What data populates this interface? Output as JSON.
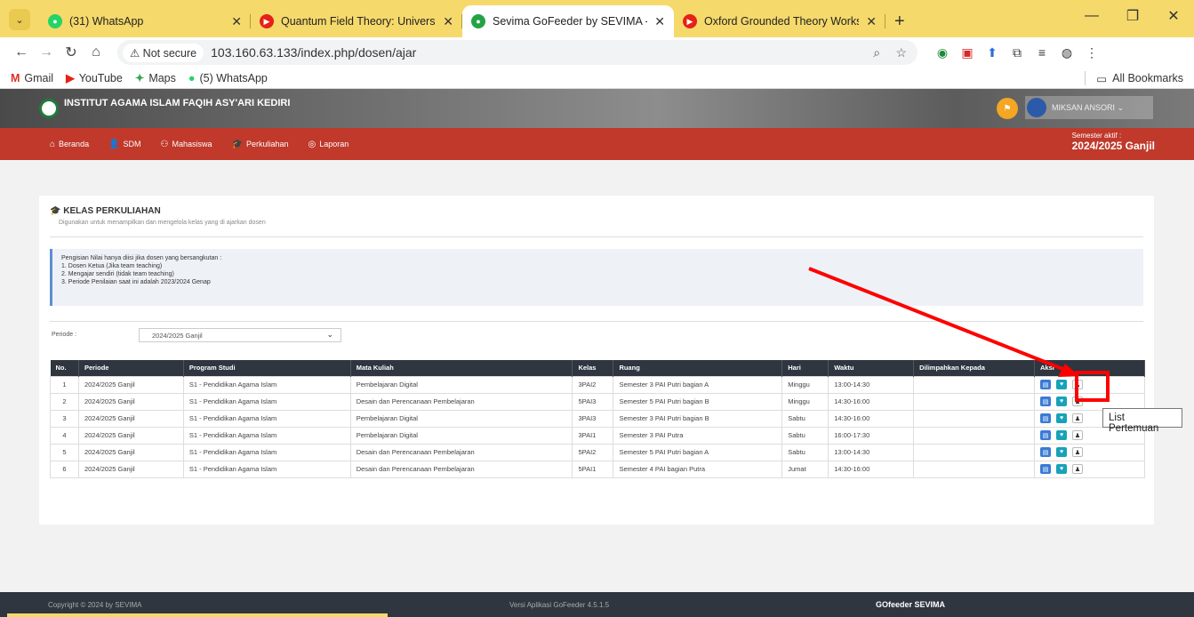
{
  "browser": {
    "tabs": [
      {
        "label": "(31) WhatsApp",
        "color": "#25d366"
      },
      {
        "label": "Quantum Field Theory: Universi",
        "color": "#e62117"
      },
      {
        "label": "Sevima GoFeeder by SEVIMA - ",
        "color": "#25a244",
        "active": true
      },
      {
        "label": "Oxford Grounded Theory Works",
        "color": "#e62117"
      }
    ],
    "not_secure": "⚠ Not secure",
    "url": "103.160.63.133/index.php/dosen/ajar",
    "bookmarks": [
      {
        "label": "Gmail",
        "icon": "M"
      },
      {
        "label": "YouTube",
        "icon": "▶"
      },
      {
        "label": "Maps",
        "icon": "✦"
      },
      {
        "label": "(5) WhatsApp",
        "icon": "●"
      }
    ],
    "all_bookmarks": "All Bookmarks"
  },
  "app": {
    "institution": "INSTITUT AGAMA ISLAM FAQIH ASY'ARI KEDIRI",
    "user_name": "MIKSAN ANSORI ⌄",
    "nav": [
      {
        "label": "Beranda",
        "icon": "⌂"
      },
      {
        "label": "SDM",
        "icon": "👤"
      },
      {
        "label": "Mahasiswa",
        "icon": "⚇"
      },
      {
        "label": "Perkuliahan",
        "icon": "🎓"
      },
      {
        "label": "Laporan",
        "icon": "◎"
      }
    ],
    "semester_label": "Semester aktif :",
    "semester_value": "2024/2025 Ganjil"
  },
  "page": {
    "title": "KELAS PERKULIAHAN",
    "title_icon": "🎓",
    "subtitle": "Digunakan untuk menampilkan dan mengelola kelas yang di ajarkan dosen",
    "note_lines": [
      "Pengisian Nilai hanya diisi jika dosen yang bersangkutan :",
      "1. Dosen Ketua (Jika team teaching)",
      "2. Mengajar sendiri (tidak team teaching)",
      "3. Periode Penilaian saat ini adalah 2023/2024 Genap"
    ],
    "periode_label": "Periode :",
    "periode_value": "2024/2025 Ganjil",
    "columns": [
      "No.",
      "Periode",
      "Program Studi",
      "Mata Kuliah",
      "Kelas",
      "Ruang",
      "Hari",
      "Waktu",
      "Dilimpahkan Kepada",
      "Aksi"
    ],
    "rows": [
      [
        "1",
        "2024/2025 Ganjil",
        "S1 - Pendidikan Agama Islam",
        "Pembelajaran Digital",
        "3PAI2",
        "Semester 3 PAI Putri bagian A",
        "Minggu",
        "13:00-14:30",
        ""
      ],
      [
        "2",
        "2024/2025 Ganjil",
        "S1 - Pendidikan Agama Islam",
        "Desain dan Perencanaan Pembelajaran",
        "5PAI3",
        "Semester 5 PAI Putri bagian B",
        "Minggu",
        "14:30-16:00",
        ""
      ],
      [
        "3",
        "2024/2025 Ganjil",
        "S1 - Pendidikan Agama Islam",
        "Pembelajaran Digital",
        "3PAI3",
        "Semester 3 PAI Putri bagian B",
        "Sabtu",
        "14:30-16:00",
        ""
      ],
      [
        "4",
        "2024/2025 Ganjil",
        "S1 - Pendidikan Agama Islam",
        "Pembelajaran Digital",
        "3PAI1",
        "Semester 3 PAI Putra",
        "Sabtu",
        "16:00-17:30",
        ""
      ],
      [
        "5",
        "2024/2025 Ganjil",
        "S1 - Pendidikan Agama Islam",
        "Desain dan Perencanaan Pembelajaran",
        "5PAI2",
        "Semester 5 PAI Putri bagian A",
        "Sabtu",
        "13:00-14:30",
        ""
      ],
      [
        "6",
        "2024/2025 Ganjil",
        "S1 - Pendidikan Agama Islam",
        "Desain dan Perencanaan Pembelajaran",
        "5PAI1",
        "Semester 4 PAI bagian Putra",
        "Jumat",
        "14:30-16:00",
        ""
      ]
    ],
    "tooltip": "List Pertemuan"
  },
  "footer": {
    "copyright": "Copyright © 2024 by SEVIMA",
    "version": "Versi Aplikasi GoFeeder 4.5.1.5",
    "brand": "GOfeeder SEVIMA"
  },
  "colors": {
    "nav_red": "#c0392b",
    "tab_yellow": "#f6d96b",
    "annotation_red": "#ff0000"
  }
}
